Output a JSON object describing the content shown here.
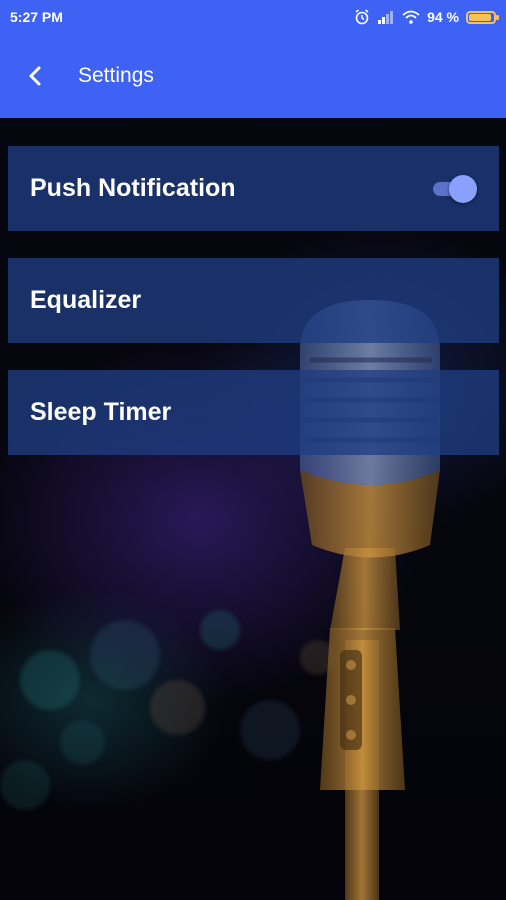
{
  "status_bar": {
    "time": "5:27 PM",
    "battery_percent": "94 %",
    "battery_level": 0.94,
    "icons": [
      "alarm-icon",
      "signal-icon",
      "wifi-icon",
      "battery-icon"
    ]
  },
  "app_bar": {
    "title": "Settings",
    "back_icon": "chevron-left-icon"
  },
  "settings": {
    "items": [
      {
        "label": "Push Notification",
        "toggle_on": true
      },
      {
        "label": "Equalizer"
      },
      {
        "label": "Sleep Timer"
      }
    ]
  },
  "colors": {
    "primary": "#3e62f3",
    "row_background": "#1f3e82",
    "toggle_thumb": "#8aa0ff",
    "battery": "#f4c25a"
  },
  "background": {
    "description_icon": "microphone-image"
  }
}
